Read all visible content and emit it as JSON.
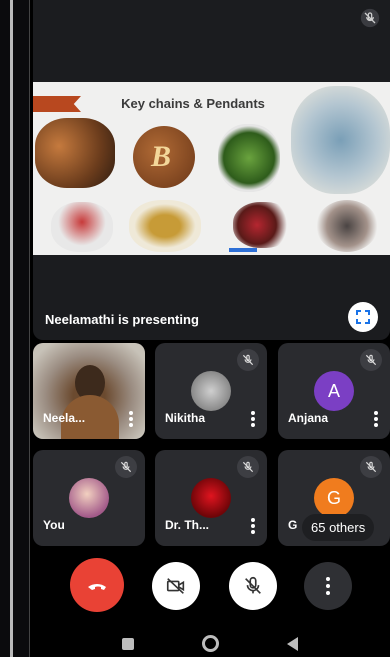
{
  "stage": {
    "slide_title": "Key chains & Pendants",
    "slide_letter": "B",
    "presenting_text": "Neelamathi is presenting"
  },
  "participants": [
    {
      "name": "Neela...",
      "kind": "video",
      "muted": false
    },
    {
      "name": "Nikitha",
      "kind": "photo",
      "muted": true
    },
    {
      "name": "Anjana",
      "kind": "initial",
      "initial": "A",
      "color": "#7b3fc4",
      "muted": true
    },
    {
      "name": "You",
      "kind": "photo",
      "muted": true
    },
    {
      "name": "Dr. Th...",
      "kind": "photo",
      "muted": true
    },
    {
      "name": "G",
      "kind": "initial",
      "initial": "G",
      "color": "#f07c1e",
      "muted": true
    }
  ],
  "others_label": "65 others",
  "controls": {
    "end_call": "end-call",
    "camera": "camera-off",
    "microphone": "microphone-off",
    "more": "more-options"
  },
  "colors": {
    "end_call": "#e94235",
    "tile_bg": "#2a2b2f",
    "anjana_avatar": "#7b3fc4",
    "g_avatar": "#f07c1e"
  }
}
